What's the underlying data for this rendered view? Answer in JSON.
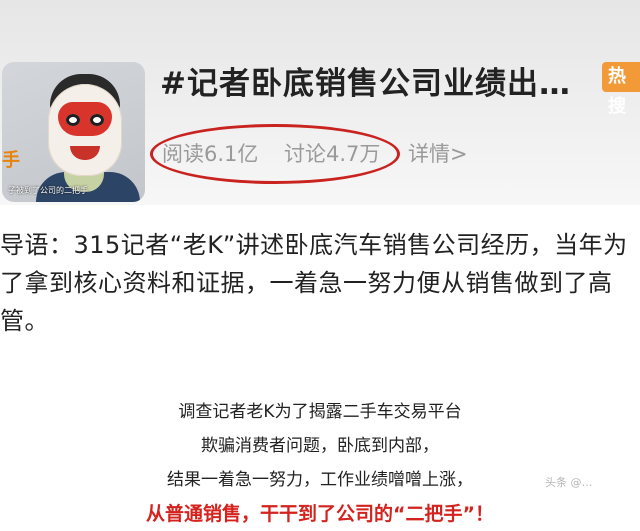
{
  "topic": {
    "title": "#记者卧底销售公司业绩出…",
    "hot_badge": "热搜",
    "read_count": "阅读6.1亿",
    "discuss_count": "讨论4.7万",
    "detail_link": "详情>",
    "thumbnail": {
      "overlay_char": "手",
      "caption": "子被到了公司的二把手"
    }
  },
  "intro": {
    "text": "导语：315记者“老K”讲述卧底汽车销售公司经历，当年为了拿到核心资料和证据，一着急一努力便从销售做到了高管。"
  },
  "article": {
    "lines": [
      "调查记者老K为了揭露二手车交易平台",
      "欺骗消费者问题，卧底到内部，",
      "结果一着急一努力，工作业绩噌噌上涨，",
      "从普通销售，干干到了公司的“二把手”！"
    ]
  },
  "watermark": "头条 @…",
  "colors": {
    "highlight_circle": "#c9231f",
    "hot_badge": "#f29a38",
    "emphasis_text": "#d4231f"
  }
}
